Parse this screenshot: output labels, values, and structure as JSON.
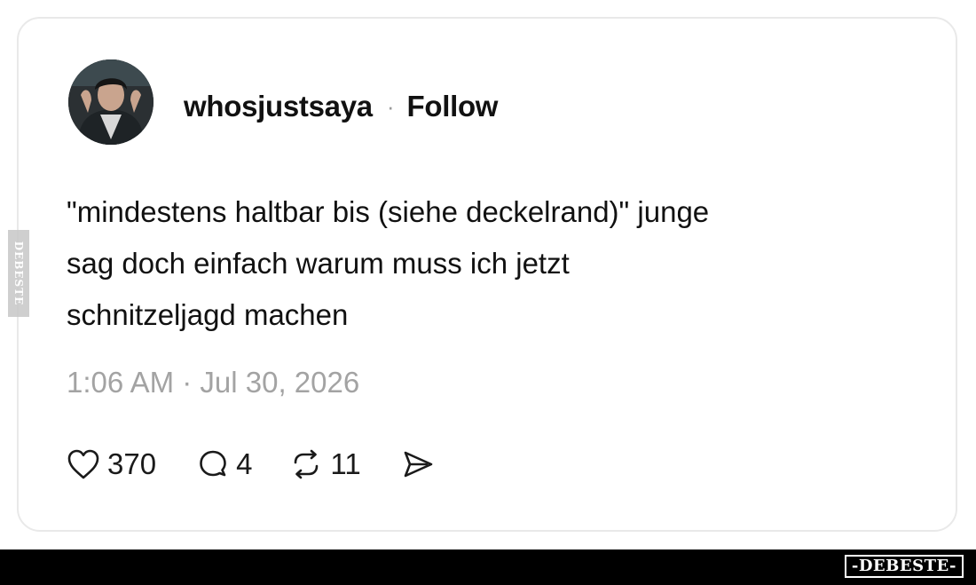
{
  "post": {
    "username": "whosjustsaya",
    "separator": "·",
    "follow_label": "Follow",
    "text_lines": [
      "\"mindestens haltbar bis (siehe deckelrand)\" junge",
      "sag doch einfach warum muss ich jetzt",
      "schnitzeljagd machen"
    ],
    "timestamp": "1:06 AM · Jul 30, 2026"
  },
  "actions": {
    "likes": {
      "icon": "heart-icon",
      "count": "370"
    },
    "replies": {
      "icon": "comment-icon",
      "count": "4"
    },
    "reposts": {
      "icon": "repost-icon",
      "count": "11"
    },
    "share": {
      "icon": "send-icon"
    }
  },
  "watermark": {
    "logo_text": "-DEBESTE-",
    "side_text": "DEBESTE"
  },
  "colors": {
    "text": "#111111",
    "muted": "#a3a3a3",
    "card_border": "#e9e9e9",
    "footer": "#000000"
  }
}
